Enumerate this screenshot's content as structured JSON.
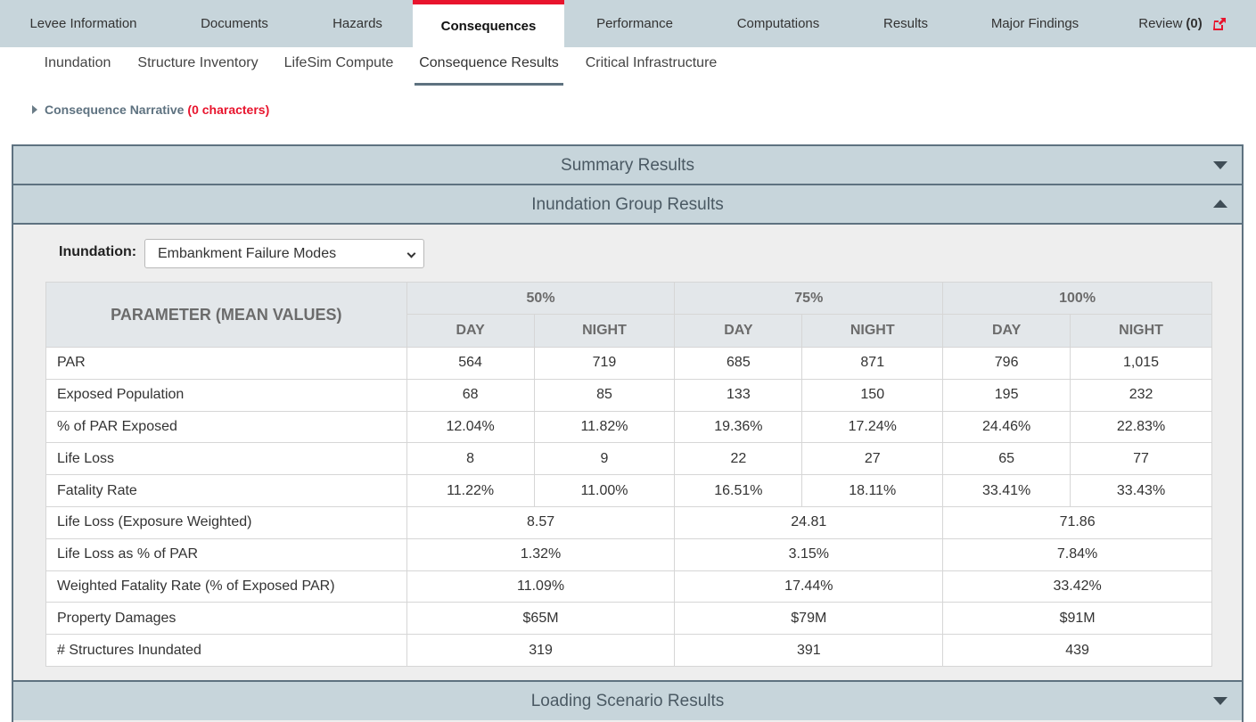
{
  "top_tabs": [
    {
      "label": "Levee Information"
    },
    {
      "label": "Documents"
    },
    {
      "label": "Hazards"
    },
    {
      "label": "Consequences"
    },
    {
      "label": "Performance"
    },
    {
      "label": "Computations"
    },
    {
      "label": "Results"
    },
    {
      "label": "Major Findings"
    },
    {
      "label": "Review",
      "count": "(0)"
    }
  ],
  "sub_tabs": [
    {
      "label": "Inundation"
    },
    {
      "label": "Structure Inventory"
    },
    {
      "label": "LifeSim Compute"
    },
    {
      "label": "Consequence Results"
    },
    {
      "label": "Critical Infrastructure"
    }
  ],
  "narrative": {
    "label": "Consequence Narrative",
    "count": "(0 characters)"
  },
  "sections": {
    "summary": "Summary Results",
    "inundation_group": "Inundation Group Results",
    "loading": "Loading Scenario Results"
  },
  "inundation": {
    "label": "Inundation:",
    "selected": "Embankment Failure Modes"
  },
  "table": {
    "param_header": "PARAMETER (MEAN VALUES)",
    "groups": [
      "50%",
      "75%",
      "100%"
    ],
    "day_label": "DAY",
    "night_label": "NIGHT",
    "split_rows": [
      {
        "name": "PAR",
        "values": [
          "564",
          "719",
          "685",
          "871",
          "796",
          "1,015"
        ]
      },
      {
        "name": "Exposed Population",
        "values": [
          "68",
          "85",
          "133",
          "150",
          "195",
          "232"
        ]
      },
      {
        "name": "% of PAR Exposed",
        "values": [
          "12.04%",
          "11.82%",
          "19.36%",
          "17.24%",
          "24.46%",
          "22.83%"
        ]
      },
      {
        "name": "Life Loss",
        "values": [
          "8",
          "9",
          "22",
          "27",
          "65",
          "77"
        ]
      },
      {
        "name": "Fatality Rate",
        "values": [
          "11.22%",
          "11.00%",
          "16.51%",
          "18.11%",
          "33.41%",
          "33.43%"
        ]
      }
    ],
    "merged_rows": [
      {
        "name": "Life Loss (Exposure Weighted)",
        "values": [
          "8.57",
          "24.81",
          "71.86"
        ]
      },
      {
        "name": "Life Loss as % of PAR",
        "values": [
          "1.32%",
          "3.15%",
          "7.84%"
        ]
      },
      {
        "name": "Weighted Fatality Rate (% of Exposed PAR)",
        "values": [
          "11.09%",
          "17.44%",
          "33.42%"
        ]
      },
      {
        "name": "Property Damages",
        "values": [
          "$65M",
          "$79M",
          "$91M"
        ]
      },
      {
        "name": "# Structures Inundated",
        "values": [
          "319",
          "391",
          "439"
        ]
      }
    ]
  },
  "colors": {
    "accent": "#e8142d",
    "nav_bg": "#c7d5db",
    "panel_border": "#5e7280"
  },
  "icons": {
    "review": "external-link-icon",
    "narrative": "caret-right-icon"
  }
}
